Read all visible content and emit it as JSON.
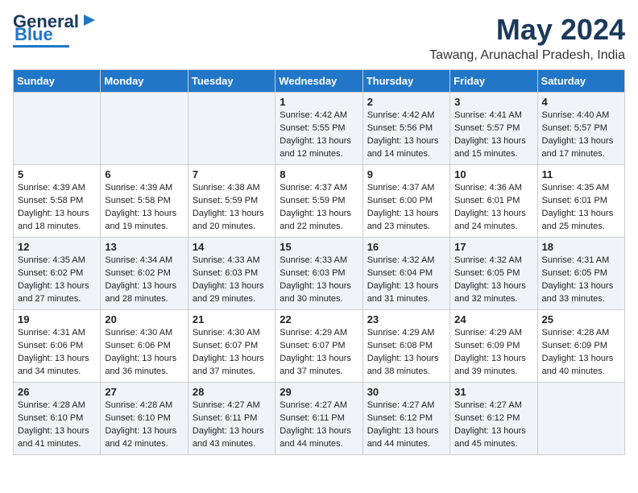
{
  "logo": {
    "line1": "General",
    "line2": "Blue"
  },
  "title": "May 2024",
  "location": "Tawang, Arunachal Pradesh, India",
  "days_of_week": [
    "Sunday",
    "Monday",
    "Tuesday",
    "Wednesday",
    "Thursday",
    "Friday",
    "Saturday"
  ],
  "weeks": [
    [
      {
        "day": "",
        "sunrise": "",
        "sunset": "",
        "daylight": ""
      },
      {
        "day": "",
        "sunrise": "",
        "sunset": "",
        "daylight": ""
      },
      {
        "day": "",
        "sunrise": "",
        "sunset": "",
        "daylight": ""
      },
      {
        "day": "1",
        "sunrise": "Sunrise: 4:42 AM",
        "sunset": "Sunset: 5:55 PM",
        "daylight": "Daylight: 13 hours and 12 minutes."
      },
      {
        "day": "2",
        "sunrise": "Sunrise: 4:42 AM",
        "sunset": "Sunset: 5:56 PM",
        "daylight": "Daylight: 13 hours and 14 minutes."
      },
      {
        "day": "3",
        "sunrise": "Sunrise: 4:41 AM",
        "sunset": "Sunset: 5:57 PM",
        "daylight": "Daylight: 13 hours and 15 minutes."
      },
      {
        "day": "4",
        "sunrise": "Sunrise: 4:40 AM",
        "sunset": "Sunset: 5:57 PM",
        "daylight": "Daylight: 13 hours and 17 minutes."
      }
    ],
    [
      {
        "day": "5",
        "sunrise": "Sunrise: 4:39 AM",
        "sunset": "Sunset: 5:58 PM",
        "daylight": "Daylight: 13 hours and 18 minutes."
      },
      {
        "day": "6",
        "sunrise": "Sunrise: 4:39 AM",
        "sunset": "Sunset: 5:58 PM",
        "daylight": "Daylight: 13 hours and 19 minutes."
      },
      {
        "day": "7",
        "sunrise": "Sunrise: 4:38 AM",
        "sunset": "Sunset: 5:59 PM",
        "daylight": "Daylight: 13 hours and 20 minutes."
      },
      {
        "day": "8",
        "sunrise": "Sunrise: 4:37 AM",
        "sunset": "Sunset: 5:59 PM",
        "daylight": "Daylight: 13 hours and 22 minutes."
      },
      {
        "day": "9",
        "sunrise": "Sunrise: 4:37 AM",
        "sunset": "Sunset: 6:00 PM",
        "daylight": "Daylight: 13 hours and 23 minutes."
      },
      {
        "day": "10",
        "sunrise": "Sunrise: 4:36 AM",
        "sunset": "Sunset: 6:01 PM",
        "daylight": "Daylight: 13 hours and 24 minutes."
      },
      {
        "day": "11",
        "sunrise": "Sunrise: 4:35 AM",
        "sunset": "Sunset: 6:01 PM",
        "daylight": "Daylight: 13 hours and 25 minutes."
      }
    ],
    [
      {
        "day": "12",
        "sunrise": "Sunrise: 4:35 AM",
        "sunset": "Sunset: 6:02 PM",
        "daylight": "Daylight: 13 hours and 27 minutes."
      },
      {
        "day": "13",
        "sunrise": "Sunrise: 4:34 AM",
        "sunset": "Sunset: 6:02 PM",
        "daylight": "Daylight: 13 hours and 28 minutes."
      },
      {
        "day": "14",
        "sunrise": "Sunrise: 4:33 AM",
        "sunset": "Sunset: 6:03 PM",
        "daylight": "Daylight: 13 hours and 29 minutes."
      },
      {
        "day": "15",
        "sunrise": "Sunrise: 4:33 AM",
        "sunset": "Sunset: 6:03 PM",
        "daylight": "Daylight: 13 hours and 30 minutes."
      },
      {
        "day": "16",
        "sunrise": "Sunrise: 4:32 AM",
        "sunset": "Sunset: 6:04 PM",
        "daylight": "Daylight: 13 hours and 31 minutes."
      },
      {
        "day": "17",
        "sunrise": "Sunrise: 4:32 AM",
        "sunset": "Sunset: 6:05 PM",
        "daylight": "Daylight: 13 hours and 32 minutes."
      },
      {
        "day": "18",
        "sunrise": "Sunrise: 4:31 AM",
        "sunset": "Sunset: 6:05 PM",
        "daylight": "Daylight: 13 hours and 33 minutes."
      }
    ],
    [
      {
        "day": "19",
        "sunrise": "Sunrise: 4:31 AM",
        "sunset": "Sunset: 6:06 PM",
        "daylight": "Daylight: 13 hours and 34 minutes."
      },
      {
        "day": "20",
        "sunrise": "Sunrise: 4:30 AM",
        "sunset": "Sunset: 6:06 PM",
        "daylight": "Daylight: 13 hours and 36 minutes."
      },
      {
        "day": "21",
        "sunrise": "Sunrise: 4:30 AM",
        "sunset": "Sunset: 6:07 PM",
        "daylight": "Daylight: 13 hours and 37 minutes."
      },
      {
        "day": "22",
        "sunrise": "Sunrise: 4:29 AM",
        "sunset": "Sunset: 6:07 PM",
        "daylight": "Daylight: 13 hours and 37 minutes."
      },
      {
        "day": "23",
        "sunrise": "Sunrise: 4:29 AM",
        "sunset": "Sunset: 6:08 PM",
        "daylight": "Daylight: 13 hours and 38 minutes."
      },
      {
        "day": "24",
        "sunrise": "Sunrise: 4:29 AM",
        "sunset": "Sunset: 6:09 PM",
        "daylight": "Daylight: 13 hours and 39 minutes."
      },
      {
        "day": "25",
        "sunrise": "Sunrise: 4:28 AM",
        "sunset": "Sunset: 6:09 PM",
        "daylight": "Daylight: 13 hours and 40 minutes."
      }
    ],
    [
      {
        "day": "26",
        "sunrise": "Sunrise: 4:28 AM",
        "sunset": "Sunset: 6:10 PM",
        "daylight": "Daylight: 13 hours and 41 minutes."
      },
      {
        "day": "27",
        "sunrise": "Sunrise: 4:28 AM",
        "sunset": "Sunset: 6:10 PM",
        "daylight": "Daylight: 13 hours and 42 minutes."
      },
      {
        "day": "28",
        "sunrise": "Sunrise: 4:27 AM",
        "sunset": "Sunset: 6:11 PM",
        "daylight": "Daylight: 13 hours and 43 minutes."
      },
      {
        "day": "29",
        "sunrise": "Sunrise: 4:27 AM",
        "sunset": "Sunset: 6:11 PM",
        "daylight": "Daylight: 13 hours and 44 minutes."
      },
      {
        "day": "30",
        "sunrise": "Sunrise: 4:27 AM",
        "sunset": "Sunset: 6:12 PM",
        "daylight": "Daylight: 13 hours and 44 minutes."
      },
      {
        "day": "31",
        "sunrise": "Sunrise: 4:27 AM",
        "sunset": "Sunset: 6:12 PM",
        "daylight": "Daylight: 13 hours and 45 minutes."
      },
      {
        "day": "",
        "sunrise": "",
        "sunset": "",
        "daylight": ""
      }
    ]
  ]
}
